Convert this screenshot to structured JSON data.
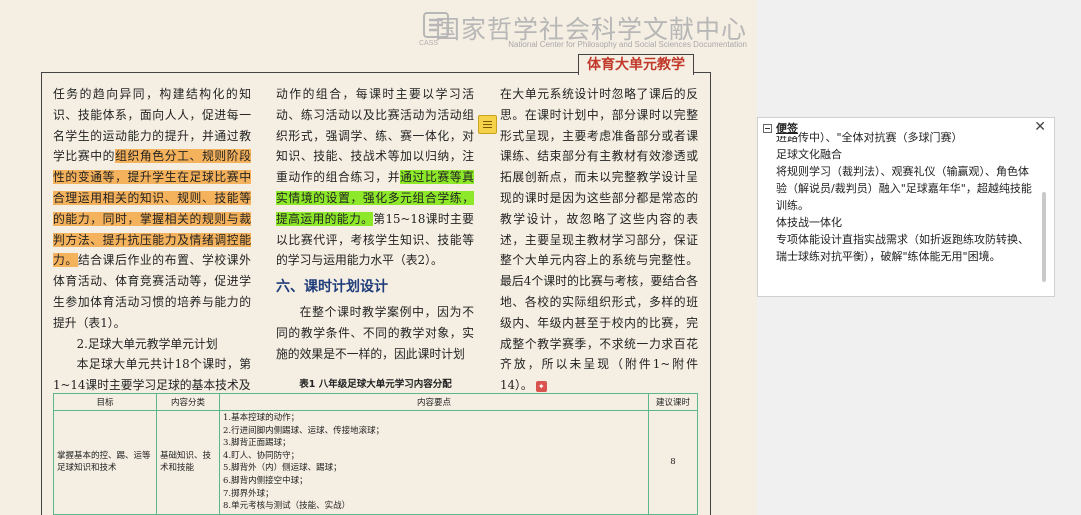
{
  "logo": {
    "cn": "国家哲学社会科学文献中心",
    "en": "National Center for Philosophy and Social Sciences Documentation",
    "abbr": "CASS"
  },
  "section_title": "体育大单元教学",
  "col1": {
    "p1_a": "任务的趋向异同，构建结构化的知识、技能体系，面向人人，促进每一名学生的运动能力的提升，并通过教学比赛中的",
    "p1_hl": "组织角色分工、规则阶段性的变通等，提升学生在足球比赛中合理运用相关的知识、规则、技能等的能力，同时，掌握相关的规则与裁判方法、提升抗压能力及情绪调控能力。",
    "p1_b": "结合课后作业的布置、学校课外体育活动、体育竞赛活动等，促进学生参加体育活动习惯的培养与能力的提升（表1）。",
    "p2": "2.足球大单元教学单元计划",
    "p3": "本足球大单元共计18个课时，第1~14课时主要学习足球的基本技术及"
  },
  "col2": {
    "p1_a": "动作的组合，每课时主要以学习活动、练习活动以及比赛活动为活动组织形式，强调学、练、赛一体化，对知识、技能、技战术等加以归纳，注重动作的组合练习，并",
    "p1_hl": "通过比赛等真实情境的设置，强化多元组合学练，提高运用的能力。",
    "p1_b": "第15~18课时主要以比赛代评，考核学生知识、技能等的学习与运用能力水平（表2）。",
    "heading": "六、课时计划设计",
    "p2": "在整个课时教学案例中，因为不同的教学条件、不同的教学对象，实施的效果是不一样的，因此课时计划"
  },
  "col3": {
    "p1": "在大单元系统设计时忽略了课后的反思。在课时计划中，部分课时以完整形式呈现，主要考虑准备部分或者课课练、结束部分有主教材有效渗透或拓展创新点，而未以完整教学设计呈现的课时是因为这些部分都是常态的教学设计，故忽略了这些内容的表述，主要呈现主教材学习部分，保证整个大单元内容上的系统与完整性。最后4个课时的比赛与考核，要结合各地、各校的实际组织形式，多样的班级内、年级内甚至于校内的比赛，完成整个教学赛季，不求统一力求百花齐放，所以未呈现（附件1~附件14）。"
  },
  "table": {
    "caption": "表1  八年级足球大单元学习内容分配",
    "headers": [
      "目标",
      "内容分类",
      "内容要点",
      "建议课时"
    ],
    "row": {
      "goal": "掌握基本的控、踢、运等足球知识和技术",
      "category": "基础知识、技术和技能",
      "points": [
        "1.基本控球的动作；",
        "2.行进间脚内侧踢球、运球、传接地滚球；",
        "3.脚背正面踢球；",
        "4.盯人、协同防守；",
        "5.脚背外（内）侧运球、踢球；",
        "6.脚背内侧接空中球；",
        "7.掷界外球；",
        "8.单元考核与测试（技能、实战）"
      ],
      "hours": "8"
    }
  },
  "sticky": {
    "title": "便签",
    "lines": [
      "进路传中）、\"全体对抗赛（多球门赛）",
      "足球文化融合",
      "将规则学习（裁判法）、观赛礼仪（输赢观）、角色体验（解说员/裁判员）融入\"足球嘉年华\"，超越纯技能训练。",
      "体技战一体化",
      "专项体能设计直指实战需求（如折返跑练攻防转换、瑞士球练对抗平衡），破解\"练体能无用\"困境。"
    ]
  },
  "colors": {
    "highlight_orange": "#f5b25c",
    "highlight_green": "#8ee82a",
    "title_red": "#c0392b",
    "heading_blue": "#1f3d7a",
    "table_border": "#5cb88a"
  },
  "icons": {
    "annotation": "note-icon",
    "end": "end-mark-icon",
    "close": "close-icon"
  }
}
